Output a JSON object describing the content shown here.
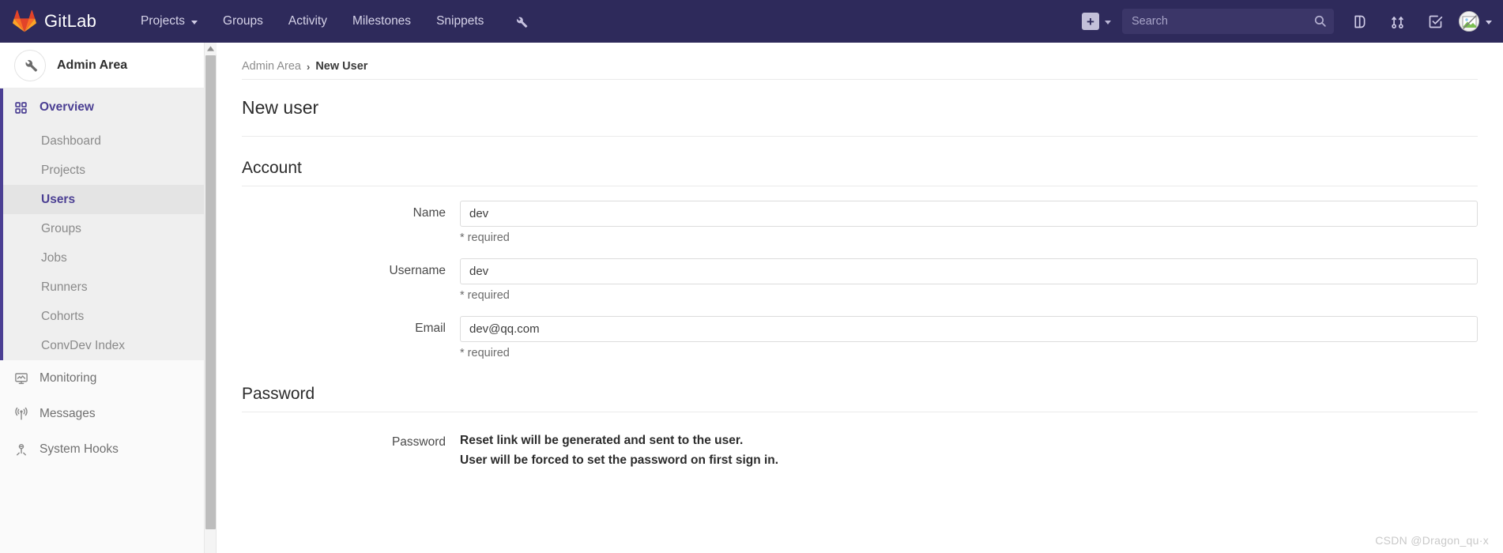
{
  "topnav": {
    "brand": "GitLab",
    "logo_icon": "gitlab-tanuki-logo",
    "links": [
      {
        "label": "Projects",
        "icon": "chevron-down-icon",
        "has_caret": true
      },
      {
        "label": "Groups",
        "has_caret": false
      },
      {
        "label": "Activity",
        "has_caret": false
      },
      {
        "label": "Milestones",
        "has_caret": false
      },
      {
        "label": "Snippets",
        "has_caret": false
      }
    ],
    "admin_icon": "wrench-icon",
    "new_icon": "plus-icon",
    "new_caret_icon": "chevron-down-icon",
    "search": {
      "placeholder": "Search",
      "value": "",
      "icon": "search-icon"
    },
    "right_icons": [
      {
        "name": "issues-icon"
      },
      {
        "name": "merge-requests-icon"
      },
      {
        "name": "todos-icon"
      }
    ],
    "avatar": {
      "name": "user-avatar",
      "caret_icon": "chevron-down-icon"
    }
  },
  "sidebar": {
    "header": {
      "title": "Admin Area",
      "icon": "wrench-icon"
    },
    "overview": {
      "label": "Overview",
      "icon": "grid-icon"
    },
    "sub_items": [
      {
        "label": "Dashboard",
        "active": false
      },
      {
        "label": "Projects",
        "active": false
      },
      {
        "label": "Users",
        "active": true
      },
      {
        "label": "Groups",
        "active": false
      },
      {
        "label": "Jobs",
        "active": false
      },
      {
        "label": "Runners",
        "active": false
      },
      {
        "label": "Cohorts",
        "active": false
      },
      {
        "label": "ConvDev Index",
        "active": false
      }
    ],
    "bottom_items": [
      {
        "label": "Monitoring",
        "icon": "monitor-icon"
      },
      {
        "label": "Messages",
        "icon": "broadcast-icon"
      },
      {
        "label": "System Hooks",
        "icon": "hook-icon"
      }
    ],
    "scrollbar": {
      "up_arrow_icon": "chevron-up-icon"
    }
  },
  "breadcrumb": {
    "root": "Admin Area",
    "separator": "›",
    "current": "New User"
  },
  "page": {
    "title": "New user"
  },
  "account": {
    "heading": "Account",
    "fields": [
      {
        "label": "Name",
        "value": "dev",
        "placeholder": "",
        "help": "* required"
      },
      {
        "label": "Username",
        "value": "dev",
        "placeholder": "",
        "help": "* required"
      },
      {
        "label": "Email",
        "value": "dev@qq.com",
        "placeholder": "",
        "help": "* required"
      }
    ]
  },
  "password": {
    "heading": "Password",
    "label": "Password",
    "line1": "Reset link will be generated and sent to the user.",
    "line2": "User will be forced to set the password on first sign in."
  },
  "watermark": "CSDN @Dragon_qu·x",
  "colors": {
    "navbar": "#2e2a5b",
    "accent": "#4b3f93",
    "sidebar_bg": "#fafafa",
    "active_sub_bg": "#e4e4e4",
    "logo_orange": "#e24329"
  }
}
